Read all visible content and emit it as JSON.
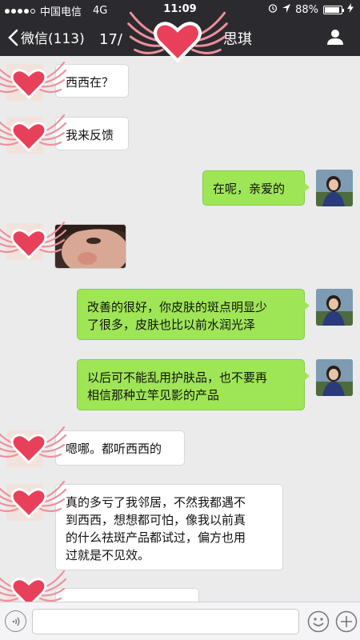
{
  "status_bar": {
    "carrier": "中国电信",
    "network": "4G",
    "time": "11:09",
    "battery": "88%",
    "battery_level": 0.88
  },
  "nav": {
    "back_label": "微信(113)",
    "title_visible_prefix": "17/",
    "title_visible_suffix": "思琪"
  },
  "messages": [
    {
      "side": "left",
      "type": "text",
      "text": "西西在？"
    },
    {
      "side": "left",
      "type": "text",
      "text": "我来反馈"
    },
    {
      "side": "right",
      "type": "text",
      "text": "在呢，亲爱的"
    },
    {
      "side": "left",
      "type": "image"
    },
    {
      "side": "right",
      "type": "text",
      "lines": [
        "改善的很好，你皮肤的斑点明显少",
        "了很多，皮肤也比以前水润光泽"
      ]
    },
    {
      "side": "right",
      "type": "text",
      "lines": [
        "以后可不能乱用护肤品，也不要再",
        "相信那种立竿见影的产品"
      ]
    },
    {
      "side": "left",
      "type": "text",
      "text": "嗯哪。都听西西的"
    },
    {
      "side": "left",
      "type": "text",
      "lines": [
        "真的多亏了我邻居，不然我都遇不",
        "到西西，想想都可怕，像我以前真",
        "的什么祛斑产品都试过，偏方也用",
        "过就是不见效。"
      ]
    }
  ],
  "colors": {
    "nav_bg": "#2b2b2f",
    "chat_bg": "#ebebeb",
    "bubble_self": "#9fe657",
    "bubble_other": "#ffffff",
    "heart": "#e8405a",
    "wing": "#ef8f9c"
  },
  "icons": [
    "chevron-left-icon",
    "user-icon",
    "voice-icon",
    "emoji-icon",
    "plus-icon",
    "wing-heart-sticker"
  ]
}
